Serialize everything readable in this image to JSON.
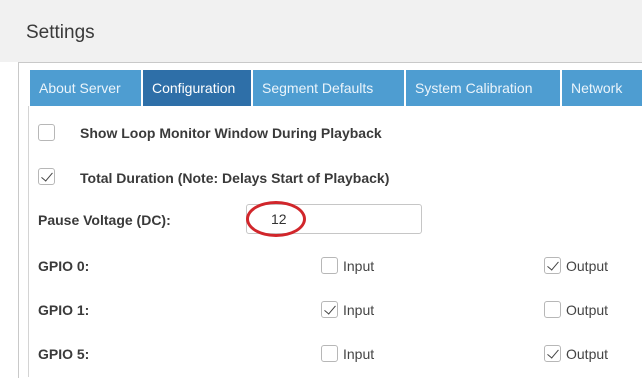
{
  "window": {
    "title": "Settings"
  },
  "tabs": [
    {
      "label": "About Server",
      "active": false
    },
    {
      "label": "Configuration",
      "active": true
    },
    {
      "label": "Segment Defaults",
      "active": false
    },
    {
      "label": "System Calibration",
      "active": false
    },
    {
      "label": "Network",
      "active": false
    }
  ],
  "options": {
    "loop_monitor": {
      "label": "Show Loop Monitor Window During Playback",
      "checked": false
    },
    "total_duration": {
      "label": "Total Duration (Note: Delays Start of Playback)",
      "checked": true
    }
  },
  "pause_voltage": {
    "label": "Pause Voltage (DC):",
    "value": "12"
  },
  "gpio": [
    {
      "label": "GPIO 0:",
      "input_label": "Input",
      "input_checked": false,
      "output_label": "Output",
      "output_checked": true
    },
    {
      "label": "GPIO 1:",
      "input_label": "Input",
      "input_checked": true,
      "output_label": "Output",
      "output_checked": false
    },
    {
      "label": "GPIO 5:",
      "input_label": "Input",
      "input_checked": false,
      "output_label": "Output",
      "output_checked": true
    }
  ],
  "colors": {
    "tab": "#4e9dd1",
    "tab_active": "#2e6fa8",
    "highlight_circle": "#d1262b"
  }
}
